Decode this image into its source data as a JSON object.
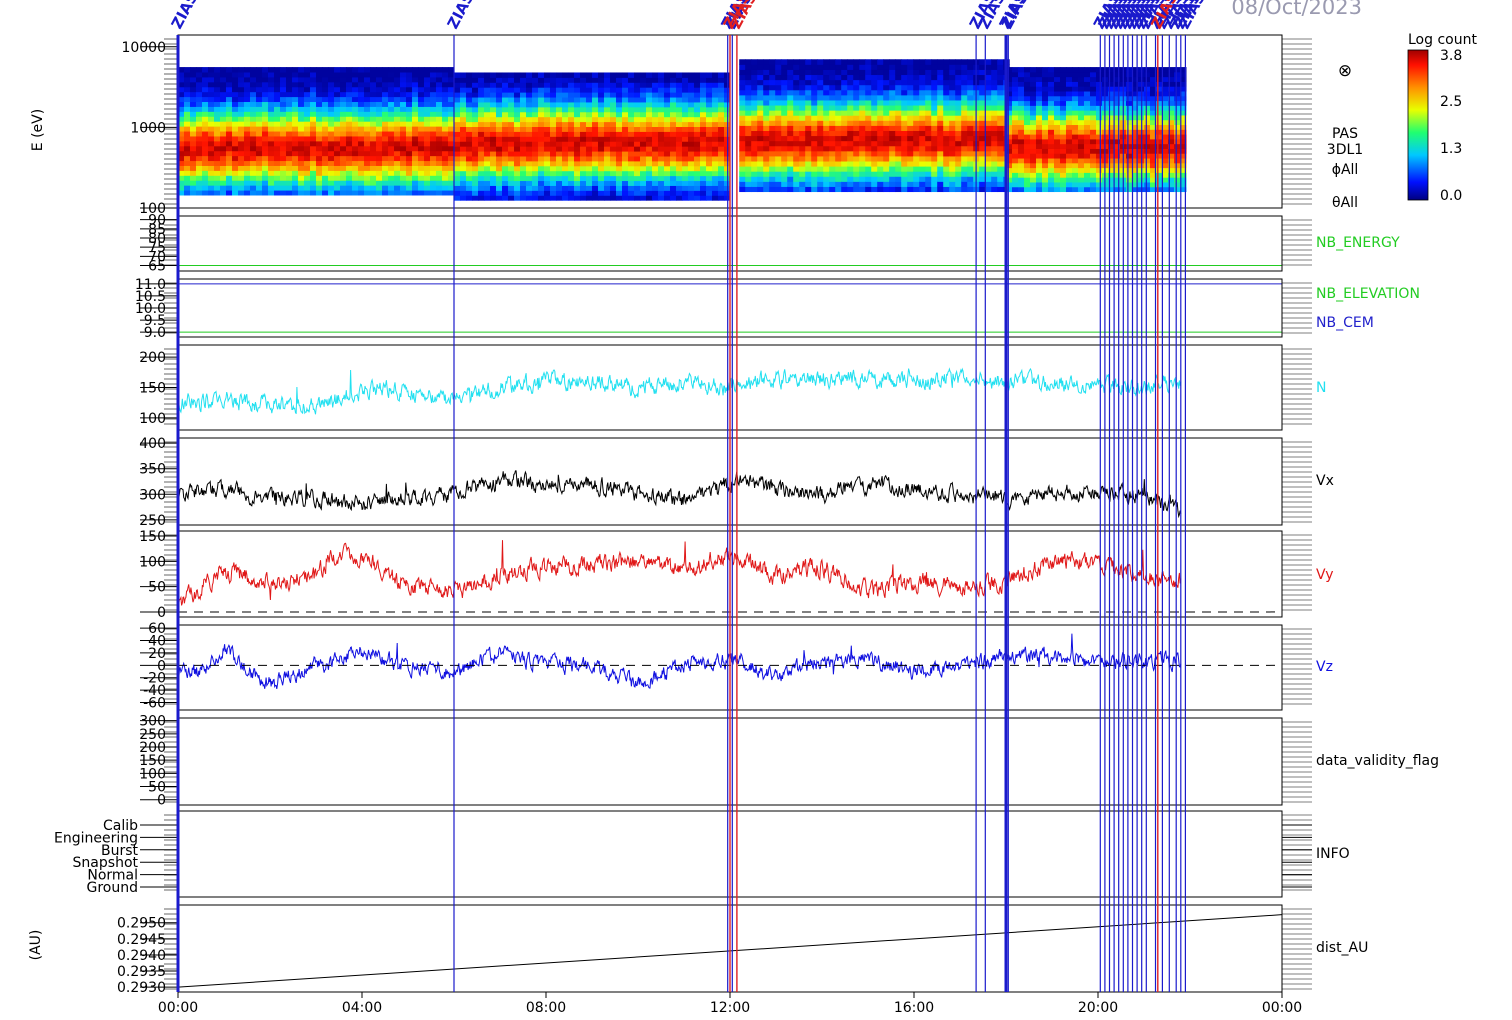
{
  "header": {
    "date": "08/Oct/2023"
  },
  "colors": {
    "frame": "#000000",
    "marker_blue": "#1a1acc",
    "marker_red": "#e02020",
    "nb_energy": "#22cc22",
    "nb_elevation": "#22cc22",
    "nb_cem": "#2222cc",
    "n": "#22e0f0",
    "vx": "#000000",
    "vy": "#e01818",
    "vz": "#1010e0"
  },
  "colorbar": {
    "title": "Log count",
    "ticks": [
      "3.8",
      "2.5",
      "1.3",
      "0.0"
    ]
  },
  "spectrogram_labels": {
    "circle_symbol": "⊗",
    "lines": [
      "PAS",
      "3DL1",
      "ϕAll",
      "θAll"
    ]
  },
  "markers": {
    "label": "ZIAS",
    "blue_hours": [
      0.0,
      6.0,
      11.95,
      12.05,
      17.35,
      17.55,
      18.0,
      18.05,
      20.05,
      20.15,
      20.25,
      20.35,
      20.45,
      20.55,
      20.65,
      20.75,
      20.85,
      20.95,
      21.05,
      21.25,
      21.4,
      21.55,
      21.7,
      21.8,
      21.9
    ],
    "red_hours": [
      12.0,
      12.15,
      21.3
    ]
  },
  "chart_data": {
    "type": "line",
    "x_axis": {
      "ticks": [
        "00:00",
        "04:00",
        "08:00",
        "12:00",
        "16:00",
        "20:00",
        "00:00"
      ],
      "range_hours": [
        0,
        24
      ]
    },
    "panels": [
      {
        "id": "spectrogram",
        "type": "heatmap",
        "ylabel": "E (eV)",
        "yscale": "log",
        "ylim": [
          100,
          14000
        ],
        "y_ticks": [
          "10000",
          "1000",
          "100"
        ],
        "data_end_hour": 21.8,
        "segments": [
          {
            "start": 0,
            "end": 6,
            "emin": 145,
            "emax": 5600,
            "peak": 560
          },
          {
            "start": 6,
            "end": 12,
            "emin": 125,
            "emax": 4800,
            "peak": 640
          },
          {
            "start": 12.2,
            "end": 18,
            "emin": 160,
            "emax": 7000,
            "peak": 700
          },
          {
            "start": 18,
            "end": 21.8,
            "emin": 160,
            "emax": 5600,
            "peak": 560
          }
        ],
        "zlim": [
          0.0,
          3.8
        ]
      },
      {
        "id": "nb_energy",
        "label": "NB_ENERGY",
        "ylim": [
          62,
          92
        ],
        "y_ticks": [
          "90",
          "85",
          "80",
          "75",
          "70",
          "65"
        ],
        "constant": 65
      },
      {
        "id": "nb_elev",
        "label": "NB_ELEVATION",
        "label2": "NB_CEM",
        "ylim": [
          8.8,
          11.2
        ],
        "y_ticks": [
          "11.0",
          "10.5",
          "10.0",
          "9.5",
          "9.0"
        ],
        "constant": 9.0,
        "constant2": 11.0
      },
      {
        "id": "n",
        "label": "N",
        "ylim": [
          80,
          220
        ],
        "y_ticks": [
          "200",
          "150",
          "100"
        ],
        "data_end_hour": 21.8,
        "baseline": {
          "x": [
            0,
            1,
            2,
            3,
            3.5,
            4,
            4.5,
            5,
            6,
            7,
            8,
            9,
            10,
            11,
            11.9,
            12.2,
            13,
            14,
            15,
            16,
            17,
            18,
            19,
            20,
            21,
            21.8
          ],
          "y": [
            125,
            130,
            122,
            118,
            130,
            145,
            150,
            140,
            130,
            150,
            160,
            158,
            150,
            160,
            150,
            160,
            162,
            165,
            165,
            160,
            165,
            160,
            160,
            155,
            150,
            160
          ]
        },
        "noise": 14
      },
      {
        "id": "vx",
        "label": "Vx",
        "ylim": [
          240,
          410
        ],
        "y_ticks": [
          "400",
          "350",
          "300",
          "250"
        ],
        "data_end_hour": 21.8,
        "baseline": {
          "x": [
            0,
            1,
            1.5,
            2,
            3,
            4,
            5,
            6,
            7,
            8,
            9,
            10,
            11,
            11.9,
            12.2,
            13,
            14,
            15,
            16,
            17,
            18,
            19,
            20,
            21,
            21.8
          ],
          "y": [
            300,
            310,
            300,
            295,
            290,
            280,
            295,
            300,
            330,
            320,
            320,
            300,
            290,
            320,
            330,
            310,
            300,
            320,
            310,
            300,
            290,
            305,
            300,
            300,
            270
          ]
        },
        "noise": 16
      },
      {
        "id": "vy",
        "label": "Vy",
        "ylim": [
          -10,
          160
        ],
        "y_ticks": [
          "150",
          "100",
          "50",
          "0"
        ],
        "dashed_zero": true,
        "data_end_hour": 21.8,
        "baseline": {
          "x": [
            0,
            0.5,
            1,
            2,
            3,
            3.5,
            4,
            5,
            6,
            7,
            8,
            9,
            10,
            11,
            11.9,
            12.2,
            13,
            14,
            15,
            16,
            17,
            18,
            19,
            20,
            21,
            21.8
          ],
          "y": [
            10,
            50,
            80,
            60,
            70,
            120,
            110,
            50,
            40,
            70,
            90,
            95,
            100,
            80,
            110,
            110,
            70,
            90,
            40,
            60,
            50,
            60,
            100,
            100,
            70,
            60
          ]
        },
        "noise": 18
      },
      {
        "id": "vz",
        "label": "Vz",
        "ylim": [
          -72,
          65
        ],
        "y_ticks": [
          "60",
          "40",
          "20",
          "0",
          "-20",
          "-40",
          "-60"
        ],
        "dashed_zero": true,
        "data_end_hour": 21.8,
        "baseline": {
          "x": [
            0,
            0.5,
            1,
            1.5,
            2,
            3,
            4,
            5,
            6,
            7,
            8,
            9,
            10,
            11,
            11.9,
            12.2,
            13,
            14,
            15,
            16,
            17,
            18,
            19,
            20,
            21,
            21.8
          ],
          "y": [
            -10,
            -10,
            30,
            -10,
            -30,
            0,
            20,
            0,
            -10,
            20,
            0,
            0,
            -30,
            0,
            10,
            10,
            -20,
            10,
            10,
            -10,
            0,
            15,
            15,
            5,
            10,
            5
          ]
        },
        "noise": 13
      },
      {
        "id": "validity",
        "label": "data_validity_flag",
        "ylim": [
          -20,
          310
        ],
        "y_ticks": [
          "300",
          "250",
          "200",
          "150",
          "100",
          "50",
          "0"
        ]
      },
      {
        "id": "info",
        "label": "INFO",
        "categories": [
          "Calib",
          "Engineering",
          "Burst",
          "Snapshot",
          "Normal",
          "Ground"
        ]
      },
      {
        "id": "dist",
        "label": "dist_AU",
        "ylabel": "(AU)",
        "ylim": [
          0.29285,
          0.29555
        ],
        "y_ticks": [
          "0.2950",
          "0.2945",
          "0.2940",
          "0.2935",
          "0.2930"
        ],
        "x": [
          0,
          24
        ],
        "y": [
          0.293,
          0.29525
        ]
      }
    ]
  }
}
